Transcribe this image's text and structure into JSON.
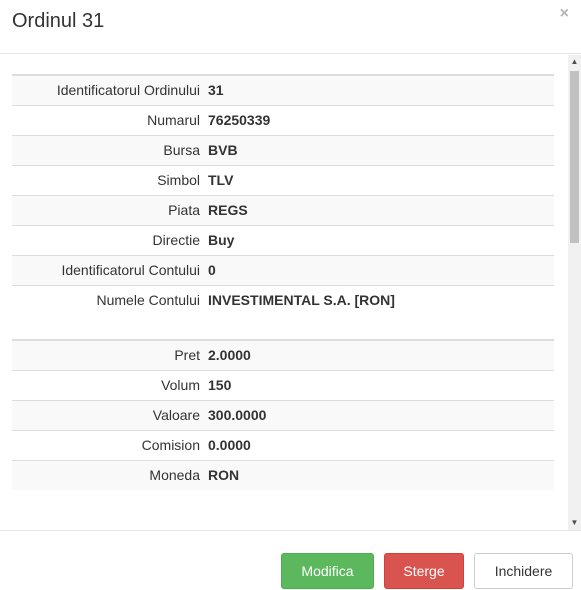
{
  "modal": {
    "title": "Ordinul 31",
    "close_symbol": "×"
  },
  "order_details": [
    {
      "label": "Identificatorul Ordinului",
      "value": "31"
    },
    {
      "label": "Numarul",
      "value": "76250339"
    },
    {
      "label": "Bursa",
      "value": "BVB"
    },
    {
      "label": "Simbol",
      "value": "TLV"
    },
    {
      "label": "Piata",
      "value": "REGS"
    },
    {
      "label": "Directie",
      "value": "Buy"
    },
    {
      "label": "Identificatorul Contului",
      "value": "0"
    },
    {
      "label": "Numele Contului",
      "value": "INVESTIMENTAL S.A. [RON]"
    }
  ],
  "price_details": [
    {
      "label": "Pret",
      "value": "2.0000"
    },
    {
      "label": "Volum",
      "value": "150"
    },
    {
      "label": "Valoare",
      "value": "300.0000"
    },
    {
      "label": "Comision",
      "value": "0.0000"
    },
    {
      "label": "Moneda",
      "value": "RON"
    }
  ],
  "scrollbar": {
    "up_arrow": "▲",
    "down_arrow": "▼"
  },
  "footer": {
    "modify_label": "Modifica",
    "delete_label": "Sterge",
    "close_label": "Inchidere"
  },
  "colors": {
    "success": "#5cb85c",
    "danger": "#d9534f",
    "default_border": "#cccccc"
  }
}
